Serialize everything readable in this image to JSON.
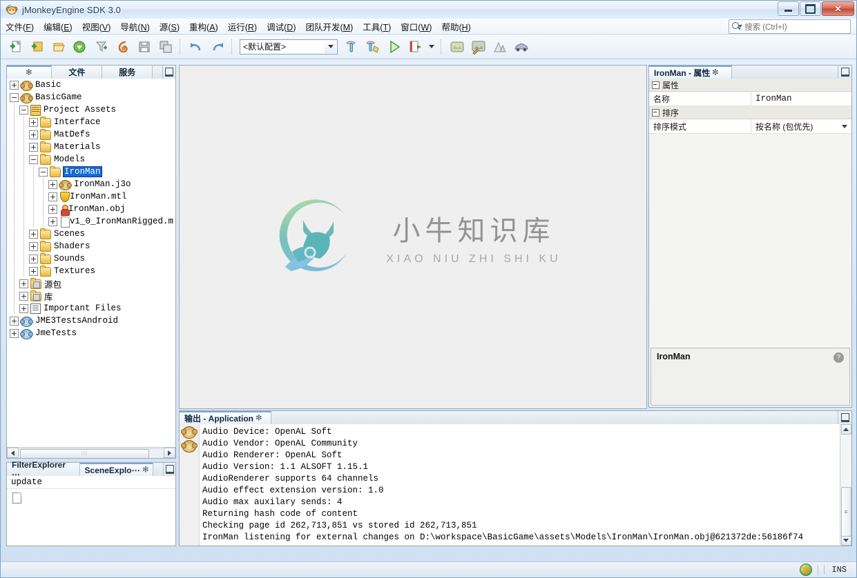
{
  "window": {
    "title": "jMonkeyEngine SDK 3.0",
    "icon": "monkey-icon",
    "buttons": {
      "minimize": "minimize",
      "maximize": "maximize",
      "close": "close"
    }
  },
  "menubar": {
    "items": [
      {
        "label": "文件",
        "mnemonic": "F"
      },
      {
        "label": "编辑",
        "mnemonic": "E"
      },
      {
        "label": "视图",
        "mnemonic": "V"
      },
      {
        "label": "导航",
        "mnemonic": "N"
      },
      {
        "label": "源",
        "mnemonic": "S"
      },
      {
        "label": "重构",
        "mnemonic": "A"
      },
      {
        "label": "运行",
        "mnemonic": "R"
      },
      {
        "label": "调试",
        "mnemonic": "D"
      },
      {
        "label": "团队开发",
        "mnemonic": "M"
      },
      {
        "label": "工具",
        "mnemonic": "T"
      },
      {
        "label": "窗口",
        "mnemonic": "W"
      },
      {
        "label": "帮助",
        "mnemonic": "H"
      }
    ]
  },
  "search": {
    "icon": "search-icon",
    "placeholder": "搜索 (Ctrl+I)",
    "value": ""
  },
  "toolbar": {
    "config_combo": {
      "value": "<默认配置>",
      "icon": "chevron-down-icon"
    },
    "buttons": [
      {
        "name": "new-file-button",
        "icon": "new-file-icon"
      },
      {
        "name": "new-project-button",
        "icon": "new-project-icon"
      },
      {
        "name": "open-project-button",
        "icon": "open-project-icon"
      },
      {
        "name": "save-all-download-button",
        "icon": "green-down-arrow-icon"
      },
      {
        "name": "filter-button",
        "icon": "funnel-icon"
      },
      {
        "name": "undo-redo-group-button",
        "icon": "swirl-icon"
      },
      {
        "name": "save-button",
        "icon": "floppy-icon"
      },
      {
        "name": "save-all-button",
        "icon": "multi-floppy-icon"
      },
      {
        "name": "undo-button",
        "icon": "undo-arrow-icon"
      },
      {
        "name": "redo-button",
        "icon": "redo-arrow-icon"
      },
      {
        "name": "build-button",
        "icon": "hammer-icon"
      },
      {
        "name": "clean-build-button",
        "icon": "hammer-broom-icon"
      },
      {
        "name": "run-button",
        "icon": "green-play-icon"
      },
      {
        "name": "debug-button",
        "icon": "debug-step-icon"
      },
      {
        "name": "debug-dropdown-button",
        "icon": "chevron-down-icon"
      },
      {
        "name": "scene-composer-button",
        "icon": "picture-icon"
      },
      {
        "name": "terrain-editor-button",
        "icon": "picture-brush-icon"
      },
      {
        "name": "terrain-button",
        "icon": "mountains-icon"
      },
      {
        "name": "vehicle-editor-button",
        "icon": "car-icon"
      }
    ]
  },
  "explorer": {
    "tabs": [
      {
        "label": "",
        "icon": "close-icon",
        "active": true,
        "name": "tab-projects"
      },
      {
        "label": "文件",
        "active": false,
        "name": "tab-files"
      },
      {
        "label": "服务",
        "active": false,
        "name": "tab-services"
      }
    ],
    "minimize_icon": "minimize-panel-icon",
    "tree": [
      {
        "depth": 0,
        "label": "Basic",
        "icon": "monkey-project-icon",
        "toggle": "plus",
        "selected": false
      },
      {
        "depth": 0,
        "label": "BasicGame",
        "icon": "monkey-project-icon",
        "toggle": "minus",
        "selected": false
      },
      {
        "depth": 1,
        "label": "Project Assets",
        "icon": "assets-icon",
        "toggle": "minus",
        "selected": false
      },
      {
        "depth": 2,
        "label": "Interface",
        "icon": "folder-icon",
        "toggle": "plus",
        "selected": false
      },
      {
        "depth": 2,
        "label": "MatDefs",
        "icon": "folder-icon",
        "toggle": "plus",
        "selected": false
      },
      {
        "depth": 2,
        "label": "Materials",
        "icon": "folder-icon",
        "toggle": "plus",
        "selected": false
      },
      {
        "depth": 2,
        "label": "Models",
        "icon": "folder-icon",
        "toggle": "minus",
        "selected": false
      },
      {
        "depth": 3,
        "label": "IronMan",
        "icon": "folder-icon",
        "toggle": "minus",
        "selected": true
      },
      {
        "depth": 4,
        "label": "IronMan.j3o",
        "icon": "monkey-model-icon",
        "toggle": "plus",
        "selected": false
      },
      {
        "depth": 4,
        "label": "IronMan.mtl",
        "icon": "shield-material-icon",
        "toggle": "plus",
        "selected": false
      },
      {
        "depth": 4,
        "label": "IronMan.obj",
        "icon": "person-model-icon",
        "toggle": "plus",
        "selected": false
      },
      {
        "depth": 4,
        "label": "v1_0_IronManRigged.m",
        "icon": "file-icon",
        "toggle": "plus",
        "selected": false
      },
      {
        "depth": 2,
        "label": "Scenes",
        "icon": "folder-icon",
        "toggle": "plus",
        "selected": false
      },
      {
        "depth": 2,
        "label": "Shaders",
        "icon": "folder-icon",
        "toggle": "plus",
        "selected": false
      },
      {
        "depth": 2,
        "label": "Sounds",
        "icon": "folder-icon",
        "toggle": "plus",
        "selected": false
      },
      {
        "depth": 2,
        "label": "Textures",
        "icon": "folder-icon",
        "toggle": "plus",
        "selected": false
      },
      {
        "depth": 1,
        "label": "源包",
        "icon": "source-packages-icon",
        "toggle": "plus",
        "selected": false,
        "cjk": true
      },
      {
        "depth": 1,
        "label": "库",
        "icon": "libraries-icon",
        "toggle": "plus",
        "selected": false,
        "cjk": true
      },
      {
        "depth": 1,
        "label": "Important Files",
        "icon": "important-files-icon",
        "toggle": "plus",
        "selected": false
      },
      {
        "depth": 0,
        "label": "JME3TestsAndroid",
        "icon": "monkey-android-icon",
        "toggle": "plus",
        "selected": false
      },
      {
        "depth": 0,
        "label": "JmeTests",
        "icon": "monkey-android-icon",
        "toggle": "plus",
        "selected": false
      }
    ],
    "hscroll": {
      "left_icon": "arrow-left-icon",
      "right_icon": "arrow-right-icon",
      "grip": "⋮⋮"
    }
  },
  "properties": {
    "tab_label": "IronMan - 属性",
    "tab_close_icon": "close-icon",
    "minimize_icon": "minimize-panel-icon",
    "groups": [
      {
        "title": "属性",
        "rows": [
          {
            "key": "名称",
            "value": "IronMan",
            "type": "text"
          }
        ]
      },
      {
        "title": "排序",
        "rows": [
          {
            "key": "排序模式",
            "value": "按名称 (包优先)",
            "type": "combo",
            "icon": "chevron-down-icon"
          }
        ]
      }
    ],
    "description": {
      "title": "IronMan",
      "help_icon": "help-icon",
      "help_glyph": "?"
    }
  },
  "output": {
    "tab_label": "输出 - Application",
    "tab_close_icon": "close-icon",
    "minimize_icon": "minimize-panel-icon",
    "gutter_icons": [
      "monkey-icon",
      "monkey-icon"
    ],
    "lines": [
      "Audio Device: OpenAL Soft",
      "Audio Vendor: OpenAL Community",
      "Audio Renderer: OpenAL Soft",
      "Audio Version: 1.1 ALSOFT 1.15.1",
      "AudioRenderer supports 64 channels",
      "Audio effect extension version: 1.0",
      "Audio max auxilary sends: 4",
      "Returning hash code of content",
      "Checking page id 262,713,851 vs stored id 262,713,851",
      "IronMan listening for external changes on D:\\workspace\\BasicGame\\assets\\Models\\IronMan\\IronMan.obj@621372de:56186f74"
    ],
    "scrollbar": {
      "up_icon": "arrow-up-icon",
      "down_icon": "arrow-down-icon"
    }
  },
  "bottom_left": {
    "tabs": [
      {
        "label": "FilterExplorer ⋯",
        "active": false,
        "name": "tab-filter-explorer"
      },
      {
        "label": "SceneExplo⋯",
        "active": true,
        "name": "tab-scene-explorer",
        "close_icon": "close-icon"
      }
    ],
    "minimize_icon": "minimize-panel-icon",
    "rows": [
      "update"
    ],
    "node_icon": "file-icon"
  },
  "canvas": {
    "watermark": {
      "cn": "小牛知识库",
      "en": "XIAO NIU ZHI SHI KU",
      "logo": "bull-circle-logo"
    }
  },
  "statusbar": {
    "icon": "refresh-globe-icon",
    "mode": "INS"
  }
}
